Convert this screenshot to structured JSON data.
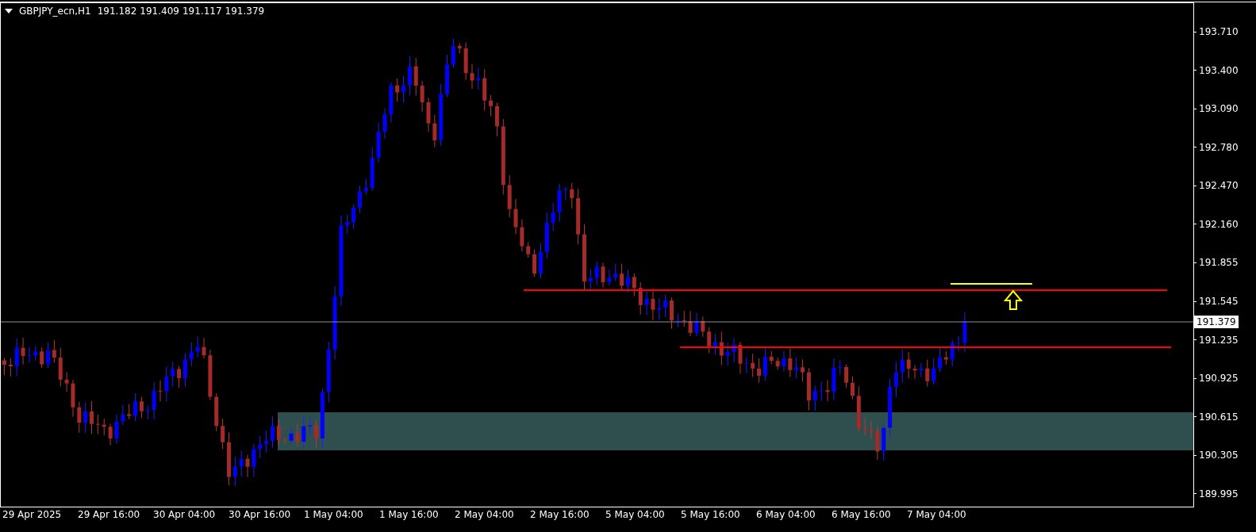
{
  "header": {
    "symbol": "GBPJPY_ecn,H1",
    "ohlc": [
      "191.182",
      "191.409",
      "191.117",
      "191.379"
    ]
  },
  "price_axis": [
    "193.710",
    "193.400",
    "193.090",
    "192.780",
    "192.470",
    "192.160",
    "191.855",
    "191.545",
    "191.235",
    "190.925",
    "190.615",
    "190.305",
    "189.995"
  ],
  "current_price": "191.379",
  "time_axis": [
    "29 Apr 2025",
    "29 Apr 16:00",
    "30 Apr 04:00",
    "30 Apr 16:00",
    "1 May 04:00",
    "1 May 16:00",
    "2 May 04:00",
    "2 May 16:00",
    "5 May 04:00",
    "5 May 16:00",
    "6 May 04:00",
    "6 May 16:00",
    "7 May 04:00"
  ]
}
